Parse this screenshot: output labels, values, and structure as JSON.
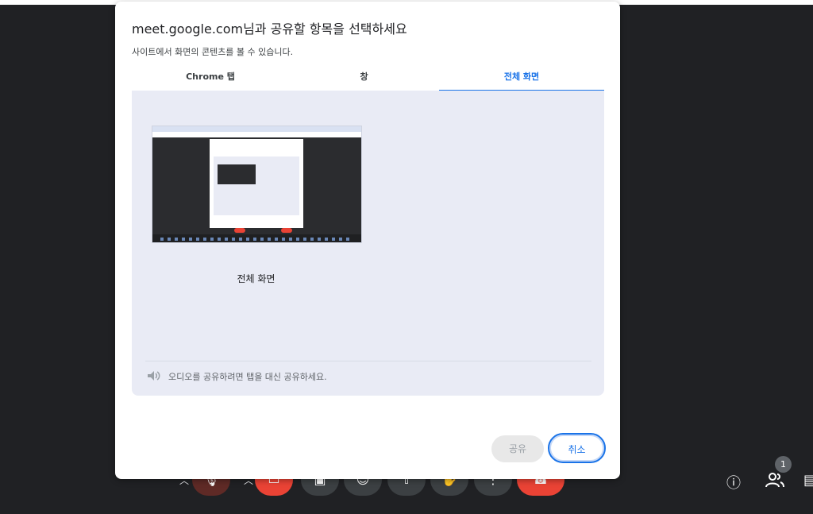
{
  "dialog": {
    "title": "meet.google.com님과 공유할 항목을 선택하세요",
    "subtitle": "사이트에서 화면의 콘텐츠를 볼 수 있습니다.",
    "tabs": [
      {
        "label": "Chrome 탭",
        "active": false
      },
      {
        "label": "창",
        "active": false
      },
      {
        "label": "전체 화면",
        "active": true
      }
    ],
    "screen_option": {
      "label": "전체 화면"
    },
    "audio_notice": "오디오를 공유하려면 탭을 대신 공유하세요.",
    "share_label": "공유",
    "cancel_label": "취소"
  },
  "meet": {
    "people_count": "1",
    "toolbar_icons": [
      "mic-off-icon",
      "camera-off-icon",
      "captions-icon",
      "emoji-icon",
      "present-icon",
      "raise-hand-icon",
      "more-options-icon",
      "end-call-icon"
    ],
    "right_icons": [
      "info-icon",
      "people-icon",
      "chat-icon"
    ]
  },
  "colors": {
    "accent": "#1a73e8",
    "end_call": "#ea4335",
    "background": "#202124"
  }
}
